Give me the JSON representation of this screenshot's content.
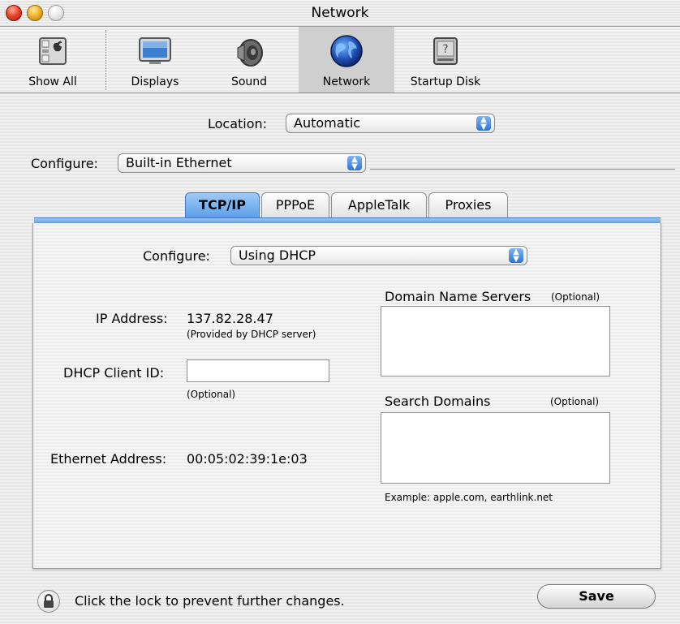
{
  "window": {
    "title": "Network"
  },
  "toolbar": {
    "items": [
      {
        "label": "Show All",
        "icon": "show-all-icon"
      },
      {
        "label": "Displays",
        "icon": "displays-icon"
      },
      {
        "label": "Sound",
        "icon": "sound-icon"
      },
      {
        "label": "Network",
        "icon": "network-globe-icon",
        "selected": true
      },
      {
        "label": "Startup Disk",
        "icon": "startup-disk-icon"
      }
    ]
  },
  "location": {
    "label": "Location:",
    "value": "Automatic"
  },
  "configure": {
    "label": "Configure:",
    "value": "Built-in Ethernet"
  },
  "tabs": [
    {
      "label": "TCP/IP",
      "active": true
    },
    {
      "label": "PPPoE"
    },
    {
      "label": "AppleTalk"
    },
    {
      "label": "Proxies"
    }
  ],
  "tcpip": {
    "configure_label": "Configure:",
    "configure_value": "Using DHCP",
    "ip_label": "IP Address:",
    "ip_value": "137.82.28.47",
    "ip_note": "(Provided by DHCP server)",
    "client_id_label": "DHCP Client ID:",
    "client_id_value": "",
    "client_id_note": "(Optional)",
    "ethernet_label": "Ethernet Address:",
    "ethernet_value": "00:05:02:39:1e:03",
    "dns_label": "Domain Name Servers",
    "dns_optional": "(Optional)",
    "search_label": "Search Domains",
    "search_optional": "(Optional)",
    "example": "Example: apple.com, earthlink.net"
  },
  "footer": {
    "lock_text": "Click the lock to prevent further changes.",
    "save_label": "Save"
  },
  "colors": {
    "accent": "#5b9ee8",
    "close": "#e8452e",
    "minimize": "#f2b42a"
  }
}
